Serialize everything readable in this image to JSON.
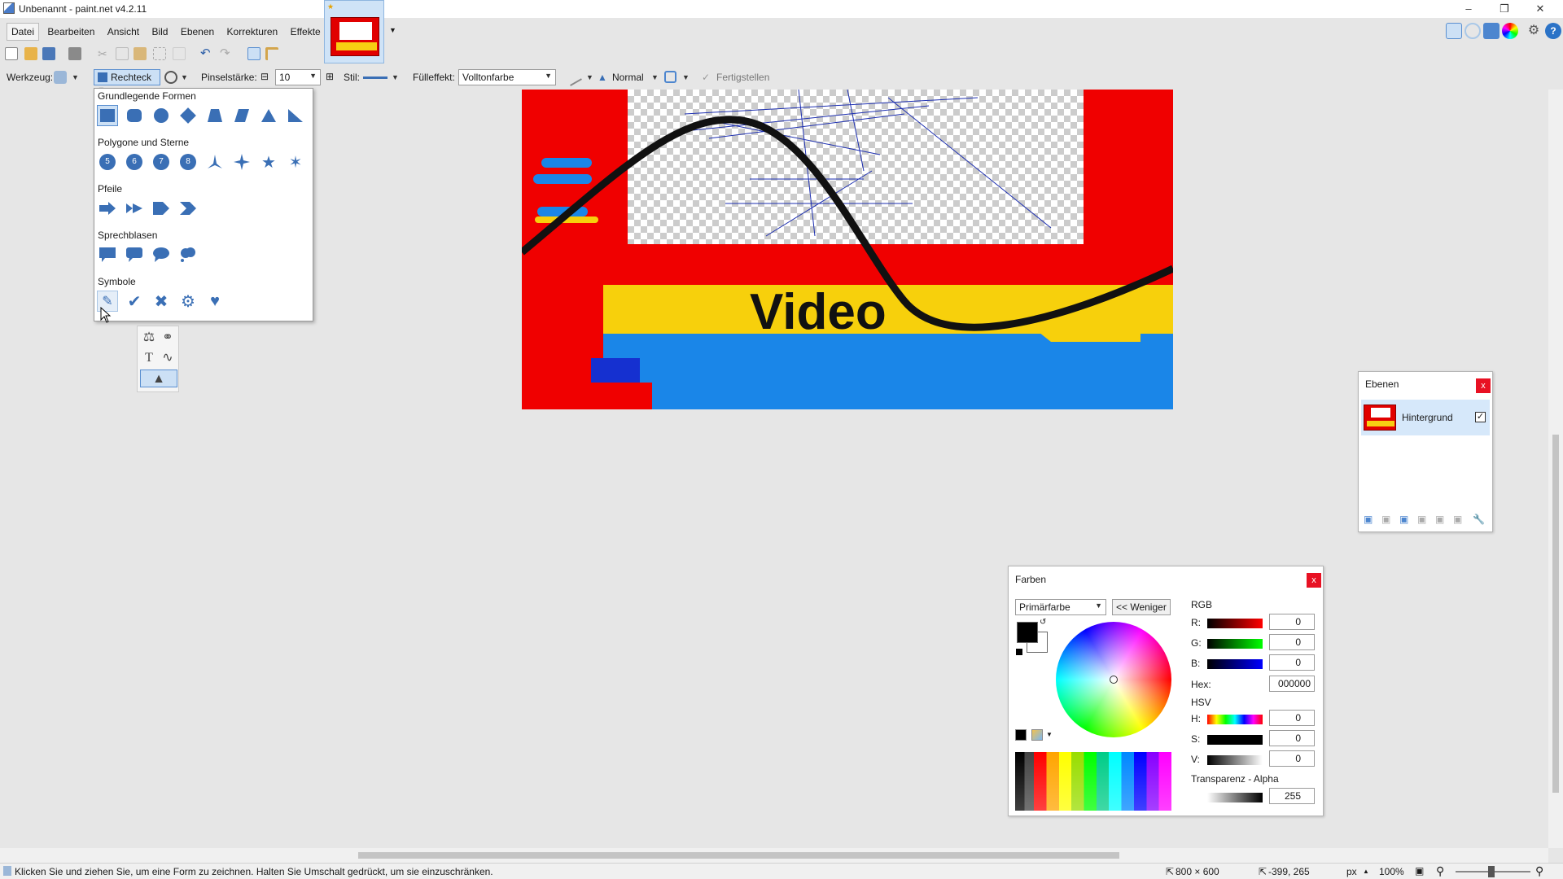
{
  "window": {
    "title": "Unbenannt - paint.net v4.2.11"
  },
  "menu": {
    "items": [
      "Datei",
      "Bearbeiten",
      "Ansicht",
      "Bild",
      "Ebenen",
      "Korrekturen",
      "Effekte"
    ]
  },
  "options": {
    "tool_label": "Werkzeug:",
    "shape_value": "Rechteck",
    "brush_label": "Pinselstärke:",
    "brush_value": "10",
    "style_label": "Stil:",
    "fill_label": "Fülleffekt:",
    "fill_value": "Volltonfarbe",
    "blend_value": "Normal",
    "finish_label": "Fertigstellen"
  },
  "shape_menu": {
    "sections": [
      "Grundlegende Formen",
      "Polygone und Sterne",
      "Pfeile",
      "Sprechblasen",
      "Symbole"
    ],
    "polygon_numbers": [
      "5",
      "6",
      "7",
      "8"
    ]
  },
  "canvas": {
    "text": "Video"
  },
  "layers": {
    "title": "Ebenen",
    "close": "x",
    "layer_name": "Hintergrund"
  },
  "colors": {
    "title": "Farben",
    "close": "x",
    "mode": "Primärfarbe",
    "less_button": "<< Weniger",
    "rgb_title": "RGB",
    "r_label": "R:",
    "r": "0",
    "g_label": "G:",
    "g": "0",
    "b_label": "B:",
    "b": "0",
    "hex_label": "Hex:",
    "hex": "000000",
    "hsv_title": "HSV",
    "h_label": "H:",
    "h": "0",
    "s_label": "S:",
    "s": "0",
    "v_label": "V:",
    "v": "0",
    "alpha_title": "Transparenz - Alpha",
    "alpha": "255"
  },
  "status": {
    "hint": "Klicken Sie und ziehen Sie, um eine Form zu zeichnen. Halten Sie Umschalt gedrückt, um sie einzuschränken.",
    "size": "800 × 600",
    "coords": "-399, 265",
    "unit": "px",
    "zoom": "100%"
  },
  "colors_accent": {
    "selection": "#cce0f5",
    "close": "#e81123",
    "canvas_red": "#f00000"
  }
}
